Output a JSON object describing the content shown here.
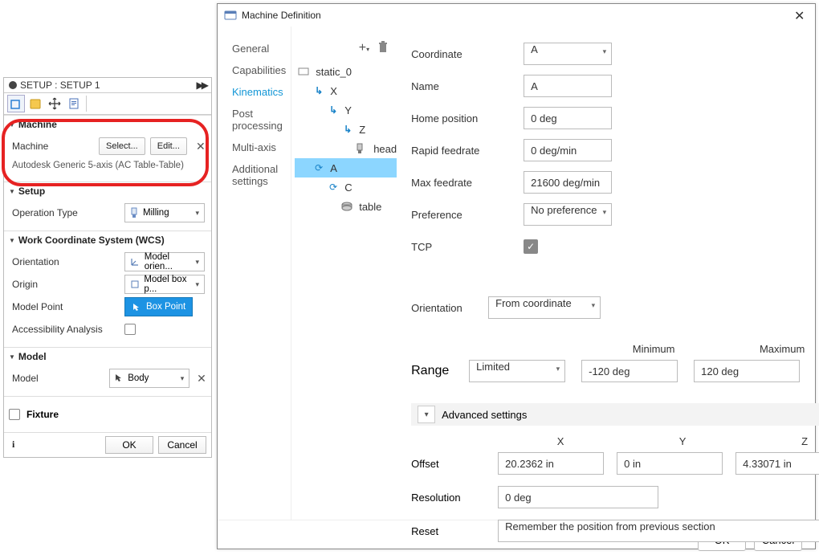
{
  "setup": {
    "title": "SETUP : SETUP 1",
    "machine_section": "Machine",
    "machine_label": "Machine",
    "select_btn": "Select...",
    "edit_btn": "Edit...",
    "machine_desc": "Autodesk Generic 5-axis (AC Table-Table)",
    "setup_section": "Setup",
    "op_type_label": "Operation Type",
    "op_type_value": "Milling",
    "wcs_section": "Work Coordinate System (WCS)",
    "orientation_label": "Orientation",
    "orientation_value": "Model orien...",
    "origin_label": "Origin",
    "origin_value": "Model box p...",
    "model_point_label": "Model Point",
    "box_point": "Box Point",
    "accessibility_label": "Accessibility Analysis",
    "model_section": "Model",
    "model_label": "Model",
    "model_value": "Body",
    "fixture_label": "Fixture",
    "ok": "OK",
    "cancel": "Cancel"
  },
  "dialog": {
    "title": "Machine Definition",
    "nav": [
      "General",
      "Capabilities",
      "Kinematics",
      "Post processing",
      "Multi-axis",
      "Additional settings"
    ],
    "nav_selected": 2,
    "tree": {
      "root": "static_0",
      "x": "X",
      "y": "Y",
      "z": "Z",
      "head": "head",
      "a": "A",
      "c": "C",
      "table": "table"
    },
    "form": {
      "coord_lbl": "Coordinate",
      "coord_val": "A",
      "name_lbl": "Name",
      "name_val": "A",
      "home_lbl": "Home position",
      "home_val": "0 deg",
      "rapid_lbl": "Rapid feedrate",
      "rapid_val": "0 deg/min",
      "maxf_lbl": "Max feedrate",
      "maxf_val": "21600 deg/min",
      "pref_lbl": "Preference",
      "pref_val": "No preference",
      "tcp_lbl": "TCP",
      "orient_lbl": "Orientation",
      "orient_val": "From coordinate",
      "min_hdr": "Minimum",
      "max_hdr": "Maximum",
      "range_lbl": "Range",
      "range_type": "Limited",
      "range_min": "-120 deg",
      "range_max": "120 deg",
      "adv_hdr": "Advanced settings",
      "x_hdr": "X",
      "y_hdr": "Y",
      "z_hdr": "Z",
      "offset_lbl": "Offset",
      "offset_x": "20.2362 in",
      "offset_y": "0 in",
      "offset_z": "4.33071 in",
      "res_lbl": "Resolution",
      "res_val": "0 deg",
      "reset_lbl": "Reset",
      "reset_val": "Remember the position from previous section"
    },
    "ok": "OK",
    "cancel": "Cancel"
  }
}
